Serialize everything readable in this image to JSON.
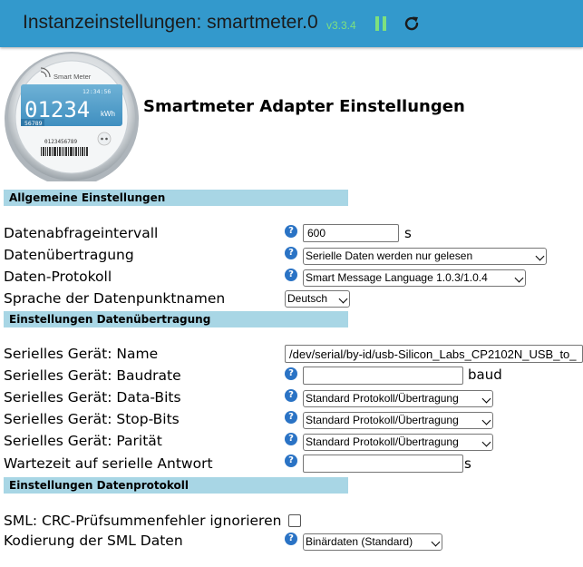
{
  "header": {
    "title": "Instanzeinstellungen: smartmeter.0",
    "version": "v3.3.4"
  },
  "logo": {
    "brand": "Smart Meter",
    "time": "12:34:56",
    "reading": "01234",
    "unit": "kWh",
    "sub": "56789",
    "serial": "0123456789"
  },
  "page_title": "Smartmeter Adapter Einstellungen",
  "sections": {
    "general": "Allgemeine Einstellungen",
    "transfer": "Einstellungen Datenübertragung",
    "protocol": "Einstellungen Datenprotokoll"
  },
  "fields": {
    "interval": {
      "label": "Datenabfrageintervall",
      "value": "600",
      "unit": "s"
    },
    "transfer": {
      "label": "Datenübertragung",
      "value": "Serielle Daten werden nur gelesen"
    },
    "protocol": {
      "label": "Daten-Protokoll",
      "value": "Smart Message Language 1.0.3/1.0.4"
    },
    "language": {
      "label": "Sprache der Datenpunktnamen",
      "value": "Deutsch"
    },
    "device_name": {
      "label": "Serielles Gerät: Name",
      "value": "/dev/serial/by-id/usb-Silicon_Labs_CP2102N_USB_to_"
    },
    "baudrate": {
      "label": "Serielles Gerät: Baudrate",
      "value": "",
      "unit": "baud"
    },
    "databits": {
      "label": "Serielles Gerät: Data-Bits",
      "value": "Standard Protokoll/Übertragung"
    },
    "stopbits": {
      "label": "Serielles Gerät: Stop-Bits",
      "value": "Standard Protokoll/Übertragung"
    },
    "parity": {
      "label": "Serielles Gerät: Parität",
      "value": "Standard Protokoll/Übertragung"
    },
    "wait": {
      "label": "Wartezeit auf serielle Antwort",
      "value": "",
      "unit": "s"
    },
    "crc": {
      "label": "SML: CRC-Prüfsummenfehler ignorieren",
      "checked": false
    },
    "encoding": {
      "label": "Kodierung der SML Daten",
      "value": "Binärdaten (Standard)"
    }
  },
  "help_glyph": "?",
  "colors": {
    "header": "#3399cc",
    "section": "#a8d6e5",
    "help": "#2a73c5",
    "version": "#7ee07e"
  }
}
